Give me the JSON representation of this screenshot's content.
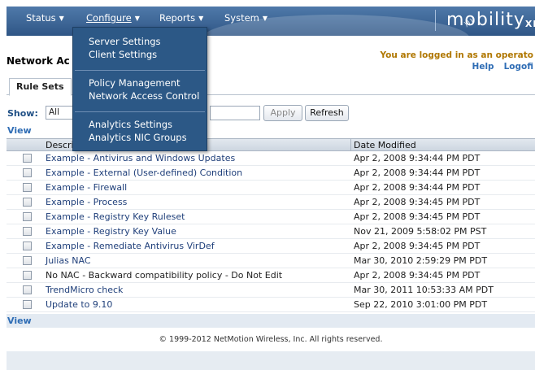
{
  "nav": {
    "items": [
      {
        "label": "Status"
      },
      {
        "label": "Configure"
      },
      {
        "label": "Reports"
      },
      {
        "label": "System"
      }
    ],
    "logo_text": "mobility",
    "logo_suffix": "XE"
  },
  "configure_menu": {
    "groups": [
      [
        "Server Settings",
        "Client Settings"
      ],
      [
        "Policy Management",
        "Network Access Control"
      ],
      [
        "Analytics Settings",
        "Analytics NIC Groups"
      ]
    ]
  },
  "header": {
    "page_title": "Network Ac",
    "login_message": "You are logged in as an operato",
    "help_label": "Help",
    "logoff_label": "Logofi"
  },
  "tabs": [
    {
      "label": "Rule Sets"
    }
  ],
  "filter": {
    "show_label": "Show:",
    "show_value": "All",
    "apply_label": "Apply",
    "refresh_label": "Refresh"
  },
  "view_label": "View",
  "table": {
    "columns": [
      "Descri",
      "Date Modified"
    ],
    "rows": [
      {
        "description": "Example - Antivirus and Windows Updates",
        "date": "Apr 2, 2008 9:34:44 PM PDT",
        "link": true
      },
      {
        "description": "Example - External (User-defined) Condition",
        "date": "Apr 2, 2008 9:34:44 PM PDT",
        "link": true
      },
      {
        "description": "Example - Firewall",
        "date": "Apr 2, 2008 9:34:44 PM PDT",
        "link": true
      },
      {
        "description": "Example - Process",
        "date": "Apr 2, 2008 9:34:45 PM PDT",
        "link": true
      },
      {
        "description": "Example - Registry Key Ruleset",
        "date": "Apr 2, 2008 9:34:45 PM PDT",
        "link": true
      },
      {
        "description": "Example - Registry Key Value",
        "date": "Nov 21, 2009 5:58:02 PM PST",
        "link": true
      },
      {
        "description": "Example - Remediate Antivirus VirDef",
        "date": "Apr 2, 2008 9:34:45 PM PDT",
        "link": true
      },
      {
        "description": "Julias NAC",
        "date": "Mar 30, 2010 2:59:29 PM PDT",
        "link": true
      },
      {
        "description": "No NAC - Backward compatibility policy - Do Not Edit",
        "date": "Apr 2, 2008 9:34:45 PM PDT",
        "link": false
      },
      {
        "description": "TrendMicro check",
        "date": "Mar 30, 2011 10:53:33 AM PDT",
        "link": true
      },
      {
        "description": "Update to 9.10",
        "date": "Sep 22, 2010 3:01:00 PM PDT",
        "link": true
      }
    ]
  },
  "footer": {
    "copyright": "© 1999-2012 NetMotion Wireless, Inc. All rights reserved."
  }
}
